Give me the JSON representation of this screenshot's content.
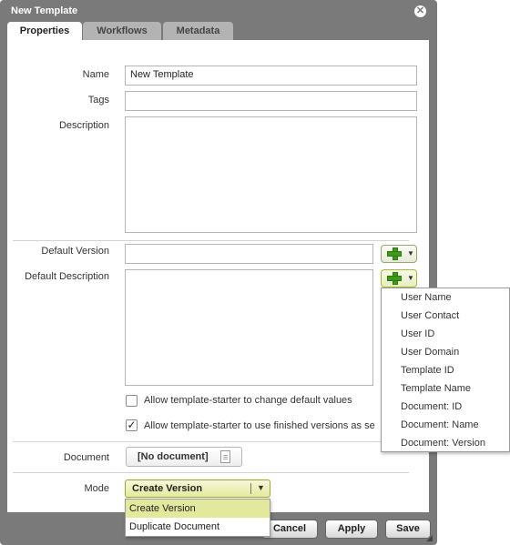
{
  "window": {
    "title": "New Template",
    "close_glyph": "✕"
  },
  "tabs": [
    {
      "label": "Properties",
      "active": true
    },
    {
      "label": "Workflows",
      "active": false
    },
    {
      "label": "Metadata",
      "active": false
    }
  ],
  "form": {
    "name_label": "Name",
    "name_value": "New Template",
    "tags_label": "Tags",
    "tags_value": "",
    "description_label": "Description",
    "description_value": "",
    "default_version_label": "Default Version",
    "default_version_value": "",
    "default_description_label": "Default Description",
    "default_description_value": "",
    "check_change_defaults": {
      "label": "Allow template-starter to change default values",
      "checked": false
    },
    "check_finished_versions": {
      "label": "Allow template-starter to use finished versions as se",
      "checked": true
    },
    "document_label": "Document",
    "document_button": "[No document]",
    "mode_label": "Mode",
    "mode_value": "Create Version",
    "mode_options": [
      "Create Version",
      "Duplicate Document"
    ]
  },
  "variables_menu": [
    "User Name",
    "User Contact",
    "User ID",
    "User Domain",
    "Template ID",
    "Template Name",
    "Document: ID",
    "Document: Name",
    "Document: Version"
  ],
  "footer": {
    "cancel": "Cancel",
    "apply": "Apply",
    "save": "Save"
  },
  "icons": {
    "plus": "green-plus-icon",
    "caret": "caret-down-icon",
    "document": "document-icon",
    "check": "checkmark-icon",
    "close": "close-icon"
  },
  "colors": {
    "dialog_frame": "#7a7a7a",
    "accent_select": "#e4ea9c",
    "plus_green": "#3d9a1c"
  }
}
